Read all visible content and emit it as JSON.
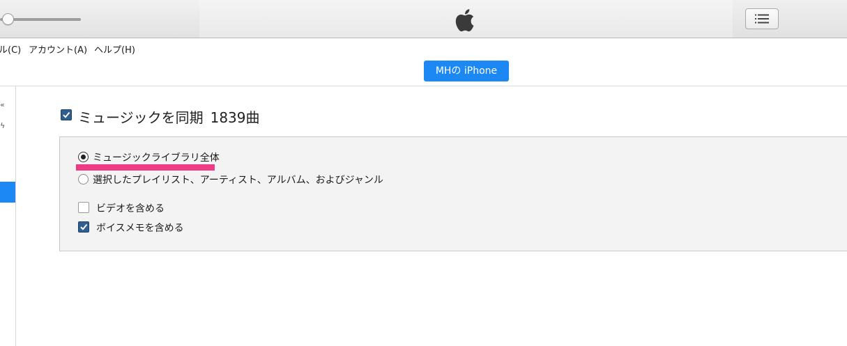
{
  "toolbar": {
    "volume_level": 0.03,
    "logo_icon": "apple-logo-icon",
    "list_icon": "list-view-icon"
  },
  "menubar": {
    "items": [
      "ル(C)",
      "アカウント(A)",
      "ヘルプ(H)"
    ]
  },
  "device": {
    "name": "MHの iPhone",
    "accent_color": "#1b88f3"
  },
  "sidebar": {
    "glyphs": [
      "«",
      "ϟ"
    ]
  },
  "sync": {
    "checked": true,
    "label": "ミュージックを同期",
    "count": "1839曲",
    "options": {
      "all_library": "ミュージックライブラリ全体",
      "selected": "選択したプレイリスト、アーティスト、アルバム、およびジャンル",
      "selected_value": "all_library"
    },
    "include_video": {
      "label": "ビデオを含める",
      "checked": false
    },
    "include_voice_memos": {
      "label": "ボイスメモを含める",
      "checked": true
    }
  },
  "annotation": {
    "highlight_color": "#ee3b86"
  }
}
